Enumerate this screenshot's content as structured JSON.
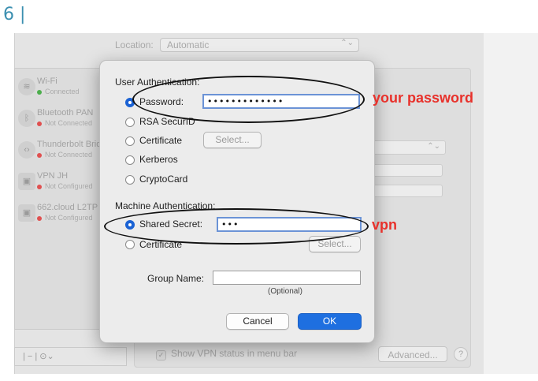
{
  "step_label": "6 |",
  "background": {
    "location_label": "Location:",
    "location_value": "Automatic",
    "services": [
      {
        "name": "Wi-Fi",
        "status": "Connected",
        "status_color": "#4cae4c",
        "icon": "wifi-icon"
      },
      {
        "name": "Bluetooth PAN",
        "status": "Not Connected",
        "status_color": "#e05050",
        "icon": "bluetooth-icon"
      },
      {
        "name": "Thunderbolt Bridge",
        "status": "Not Connected",
        "status_color": "#e05050",
        "icon": "thunderbolt-icon"
      },
      {
        "name": "VPN JH",
        "status": "Not Configured",
        "status_color": "#e05050",
        "icon": "vpn-lock-icon"
      },
      {
        "name": "662.cloud L2TP",
        "status": "Not Configured",
        "status_color": "#e05050",
        "icon": "vpn-lock-icon"
      }
    ],
    "sidebar_footer": "| − | ⊙⌄",
    "show_vpn_status": "Show VPN status in menu bar",
    "advanced_button": "Advanced...",
    "help_button": "?"
  },
  "dialog": {
    "user_auth_title": "User Authentication:",
    "user_options": [
      {
        "label": "Password:",
        "selected": true
      },
      {
        "label": "RSA SecurID",
        "selected": false
      },
      {
        "label": "Certificate",
        "selected": false
      },
      {
        "label": "Kerberos",
        "selected": false
      },
      {
        "label": "CryptoCard",
        "selected": false
      }
    ],
    "password_value": "•••••••••••••",
    "user_cert_select": "Select...",
    "machine_auth_title": "Machine Authentication:",
    "machine_options": [
      {
        "label": "Shared Secret:",
        "selected": true
      },
      {
        "label": "Certificate",
        "selected": false
      }
    ],
    "shared_secret_value": "•••",
    "machine_cert_select": "Select...",
    "group_name_label": "Group Name:",
    "group_name_value": "",
    "optional_hint": "(Optional)",
    "cancel_button": "Cancel",
    "ok_button": "OK"
  },
  "annotations": {
    "password_note": "your password",
    "secret_note": "vpn"
  },
  "colors": {
    "accent": "#1e6fe0",
    "annotation": "#e8312b"
  }
}
